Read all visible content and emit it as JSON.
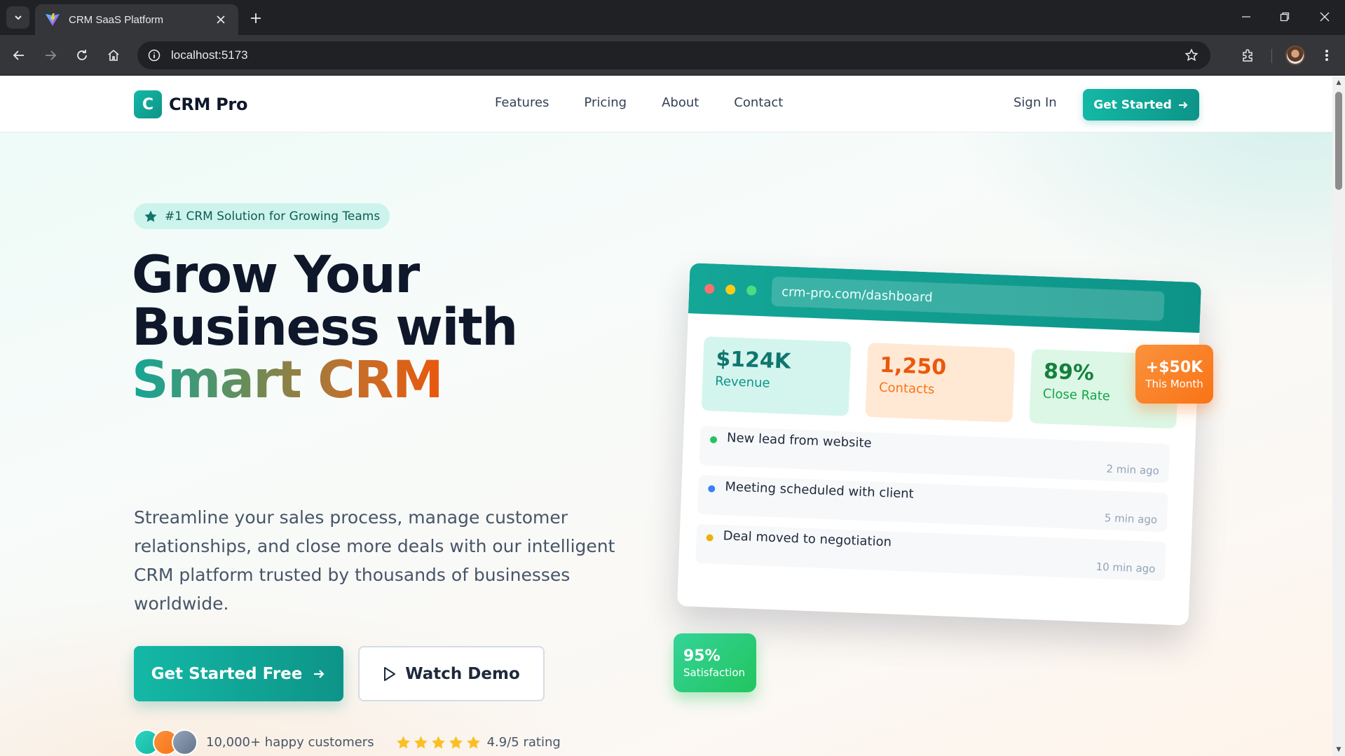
{
  "browser": {
    "tab_title": "CRM SaaS Platform",
    "url": "localhost:5173"
  },
  "nav": {
    "brand_letter": "C",
    "brand_name": "CRM Pro",
    "links": [
      "Features",
      "Pricing",
      "About",
      "Contact"
    ],
    "sign_in": "Sign In",
    "cta": "Get Started"
  },
  "hero": {
    "badge": "#1 CRM Solution for Growing Teams",
    "headline_line1": "Grow Your",
    "headline_line2": "Business with",
    "headline_highlight": "Smart CRM",
    "subcopy": "Streamline your sales process, manage customer relationships, and close more deals with our intelligent CRM platform trusted by thousands of businesses worldwide.",
    "primary_button": "Get Started Free",
    "secondary_button": "Watch Demo",
    "customers_text": "10,000+ happy customers",
    "rating_stars": 5,
    "rating_text": "4.9/5 rating"
  },
  "dashboard": {
    "url": "crm-pro.com/dashboard",
    "stats": [
      {
        "value": "$124K",
        "label": "Revenue"
      },
      {
        "value": "1,250",
        "label": "Contacts"
      },
      {
        "value": "89%",
        "label": "Close Rate"
      }
    ],
    "activity": [
      {
        "text": "New lead from website",
        "time": "2 min ago",
        "color": "#22c55e"
      },
      {
        "text": "Meeting scheduled with client",
        "time": "5 min ago",
        "color": "#3b82f6"
      },
      {
        "text": "Deal moved to negotiation",
        "time": "10 min ago",
        "color": "#eab308"
      }
    ],
    "badge_top": {
      "value": "+$50K",
      "label": "This Month"
    },
    "badge_bottom": {
      "value": "95%",
      "label": "Satisfaction"
    }
  },
  "colors": {
    "brand": "#14b8a6",
    "brand_dark": "#0d9488",
    "accent_orange": "#f97316",
    "accent_green": "#22c55e",
    "star": "#fbbf24"
  }
}
